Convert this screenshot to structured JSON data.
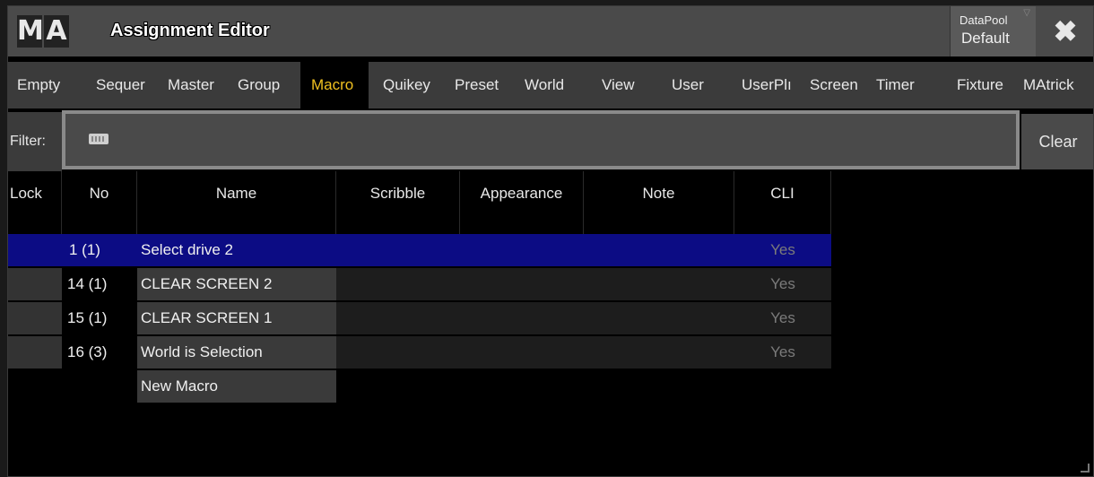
{
  "window": {
    "logo": [
      "M",
      "A"
    ],
    "title": "Assignment Editor",
    "datapool_label": "DataPool",
    "datapool_value": "Default",
    "close_glyph": "✖"
  },
  "tabs": [
    {
      "label": "Empty",
      "active": false
    },
    {
      "label": "Sequer",
      "active": false
    },
    {
      "label": "Master",
      "active": false
    },
    {
      "label": "Group",
      "active": false
    },
    {
      "label": "Macro",
      "active": true
    },
    {
      "label": "Quikey",
      "active": false
    },
    {
      "label": "Preset",
      "active": false
    },
    {
      "label": "World",
      "active": false
    },
    {
      "label": "View",
      "active": false
    },
    {
      "label": "User",
      "active": false
    },
    {
      "label": "UserPlı",
      "active": false
    },
    {
      "label": "Screen",
      "active": false
    },
    {
      "label": "Timer",
      "active": false
    },
    {
      "label": "Fixture",
      "active": false
    },
    {
      "label": "MAtrick",
      "active": false
    }
  ],
  "filter": {
    "label": "Filter:",
    "value": "",
    "icon": "keyboard-icon",
    "clear_label": "Clear"
  },
  "table": {
    "columns": [
      "Lock",
      "No",
      "Name",
      "Scribble",
      "Appearance",
      "Note",
      "CLI"
    ],
    "rows": [
      {
        "no": "1 (1)",
        "name": "Select drive 2",
        "cli": "Yes",
        "selected": true
      },
      {
        "no": "14 (1)",
        "name": "CLEAR SCREEN 2",
        "cli": "Yes",
        "selected": false
      },
      {
        "no": "15 (1)",
        "name": "CLEAR SCREEN 1",
        "cli": "Yes",
        "selected": false
      },
      {
        "no": "16 (3)",
        "name": "World is Selection",
        "cli": "Yes",
        "selected": false
      }
    ],
    "new_item_label": "New Macro"
  },
  "colors": {
    "active_tab_text": "#f0c020",
    "selected_row": "#0c0c84",
    "titlebar": "#4a4a4a"
  }
}
